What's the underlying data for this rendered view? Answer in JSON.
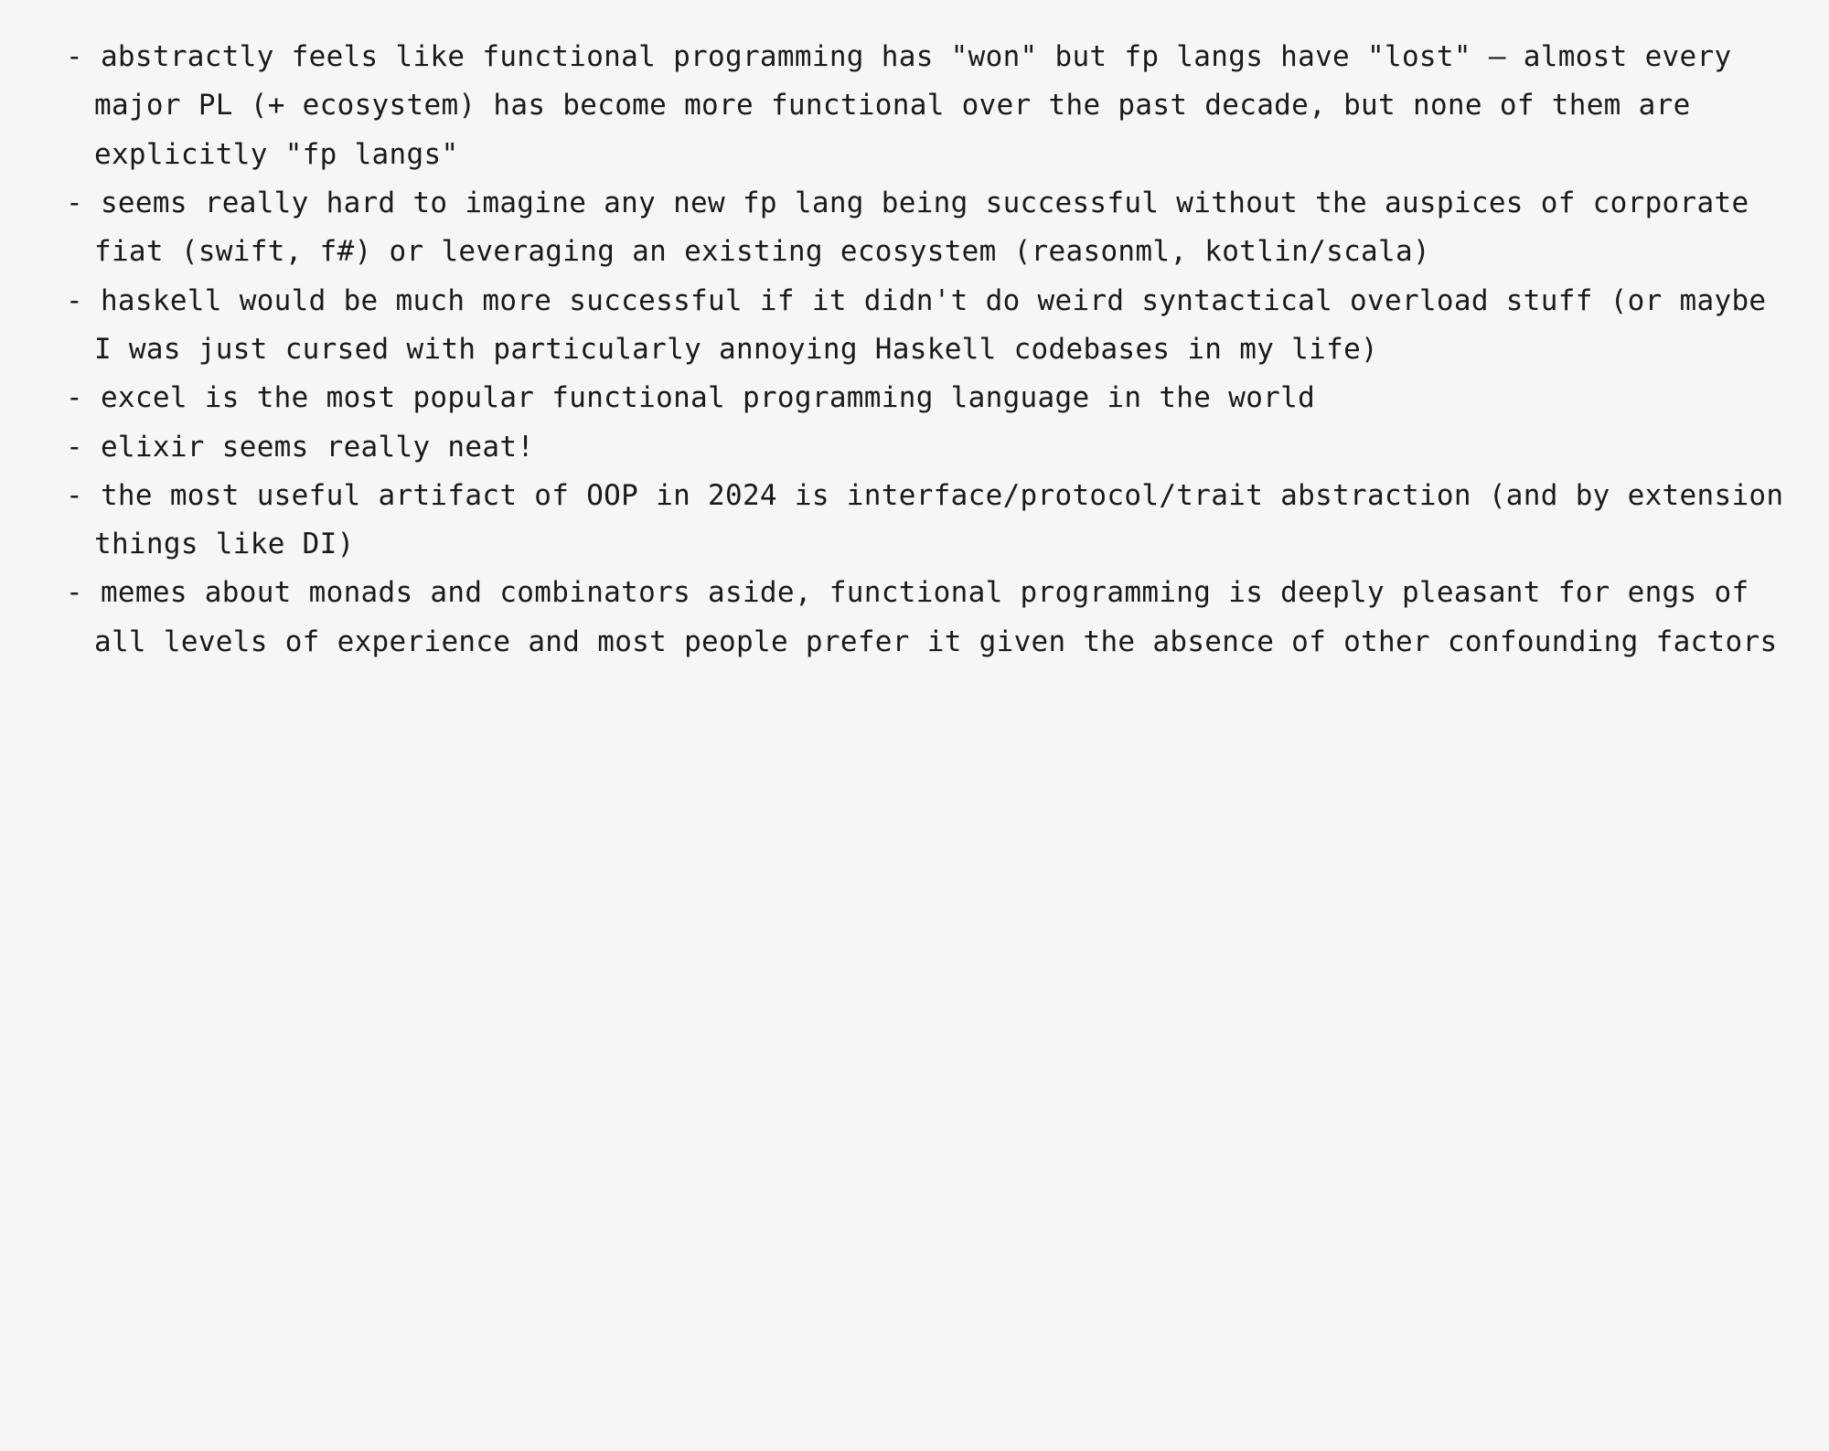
{
  "bullets": [
    "abstractly feels like functional programming has \"won\" but fp langs have \"lost\" — almost every major PL (+ ecosystem) has become more functional over the past decade, but none of them are explicitly \"fp langs\"",
    "seems really hard to imagine any new fp lang being successful without the auspices of corporate fiat (swift, f#) or leveraging an existing ecosystem (reasonml, kotlin/scala)",
    "haskell would be much more successful if it didn't do weird syntactical overload stuff (or maybe I was just cursed with particularly annoying Haskell codebases in my life)",
    "excel is the most popular functional programming language in the world",
    "elixir seems really neat!",
    "the most useful artifact of OOP in 2024 is interface/protocol/trait abstraction (and by extension things like DI)",
    "memes about monads and combinators aside, functional programming is deeply pleasant for engs of all levels of experience and most people prefer it given the absence of other confounding factors"
  ]
}
